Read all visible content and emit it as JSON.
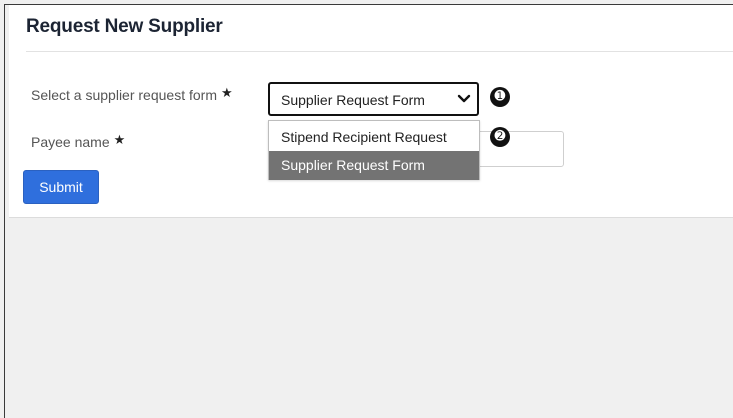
{
  "page": {
    "title": "Request New Supplier"
  },
  "form": {
    "supplier_form_label": "Select a supplier request form",
    "payee_label": "Payee name",
    "required_marker": "★",
    "selected_value": "Supplier Request Form",
    "options": [
      {
        "label": "Stipend Recipient Request",
        "selected": false
      },
      {
        "label": "Supplier Request Form",
        "selected": true
      }
    ],
    "submit_label": "Submit"
  },
  "callouts": [
    "➊",
    "➋"
  ],
  "colors": {
    "submit_bg": "#2f6fdd",
    "selected_option_bg": "#737373",
    "page_bg": "#f0f0f0"
  },
  "icons": {
    "dropdown": "chevron-down-icon"
  }
}
